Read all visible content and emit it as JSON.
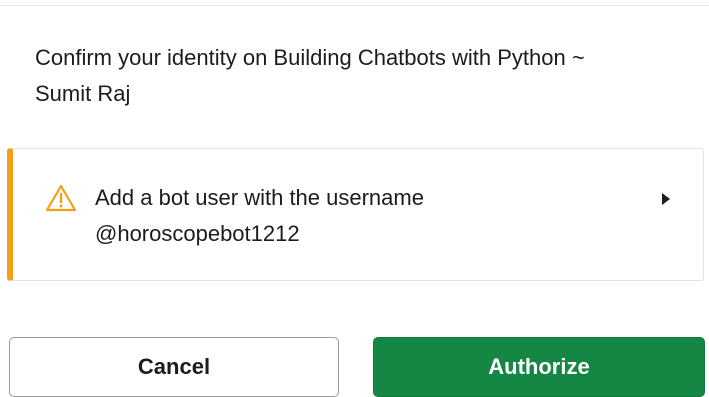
{
  "dialog": {
    "title": "Confirm your identity on Building Chatbots with Python ~ Sumit Raj"
  },
  "permission": {
    "icon": "warning-triangle-icon",
    "text_line1": "Add a bot user with the username",
    "text_line2": "@horoscopebot1212",
    "expand_icon": "caret-right-icon",
    "accent_color": "#f2a019"
  },
  "actions": {
    "cancel_label": "Cancel",
    "authorize_label": "Authorize",
    "authorize_color": "#148744"
  }
}
